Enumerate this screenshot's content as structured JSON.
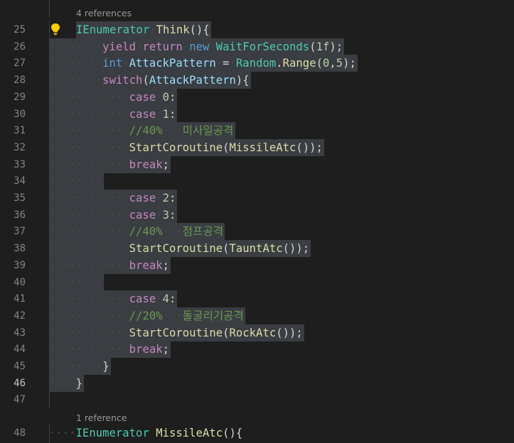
{
  "editor": {
    "codelens": [
      {
        "before_line": "25",
        "text": "4 references"
      },
      {
        "before_line": "48",
        "text": "1 reference"
      }
    ],
    "lightbulb_icon": "lightbulb-icon",
    "active_line": "46",
    "lines": [
      {
        "num": "25",
        "sel": true,
        "tokens": [
          [
            "ty",
            "IEnumerator"
          ],
          [
            "ws",
            "·"
          ],
          [
            "fn",
            "Think"
          ],
          [
            "pl",
            "(){"
          ]
        ]
      },
      {
        "num": "26",
        "sel": true,
        "tokens": [
          [
            "ws",
            "········"
          ],
          [
            "ctl",
            "yield"
          ],
          [
            "ws",
            "·"
          ],
          [
            "ctl",
            "return"
          ],
          [
            "ws",
            "·"
          ],
          [
            "kw",
            "new"
          ],
          [
            "ws",
            "·"
          ],
          [
            "ty",
            "WaitForSeconds"
          ],
          [
            "pl",
            "("
          ],
          [
            "numl",
            "1f"
          ],
          [
            "pl",
            ");"
          ]
        ]
      },
      {
        "num": "27",
        "sel": true,
        "tokens": [
          [
            "ws",
            "········"
          ],
          [
            "kw",
            "int"
          ],
          [
            "ws",
            "·"
          ],
          [
            "var",
            "AttackPattern"
          ],
          [
            "ws",
            "·"
          ],
          [
            "pl",
            "="
          ],
          [
            "ws",
            "·"
          ],
          [
            "ty",
            "Random"
          ],
          [
            "pl",
            "."
          ],
          [
            "fn",
            "Range"
          ],
          [
            "pl",
            "("
          ],
          [
            "numl",
            "0"
          ],
          [
            "pl",
            ","
          ],
          [
            "numl",
            "5"
          ],
          [
            "pl",
            ");"
          ]
        ]
      },
      {
        "num": "28",
        "sel": true,
        "tokens": [
          [
            "ws",
            "········"
          ],
          [
            "ctl",
            "switch"
          ],
          [
            "pl",
            "("
          ],
          [
            "var",
            "AttackPattern"
          ],
          [
            "pl",
            "){"
          ]
        ]
      },
      {
        "num": "29",
        "sel": true,
        "tokens": [
          [
            "ws",
            "············"
          ],
          [
            "ctl",
            "case"
          ],
          [
            "ws",
            "·"
          ],
          [
            "numl",
            "0"
          ],
          [
            "pl",
            ":"
          ]
        ]
      },
      {
        "num": "30",
        "sel": true,
        "tokens": [
          [
            "ws",
            "············"
          ],
          [
            "ctl",
            "case"
          ],
          [
            "ws",
            "·"
          ],
          [
            "numl",
            "1"
          ],
          [
            "pl",
            ":"
          ]
        ]
      },
      {
        "num": "31",
        "sel": true,
        "tokens": [
          [
            "ws",
            "············"
          ],
          [
            "cmt",
            "//40%"
          ],
          [
            "ws",
            "·-·"
          ],
          [
            "cmt",
            "미사일공격"
          ]
        ]
      },
      {
        "num": "32",
        "sel": true,
        "tokens": [
          [
            "ws",
            "············"
          ],
          [
            "fn",
            "StartCoroutine"
          ],
          [
            "pl",
            "("
          ],
          [
            "fn",
            "MissileAtc"
          ],
          [
            "pl",
            "());"
          ]
        ]
      },
      {
        "num": "33",
        "sel": true,
        "tokens": [
          [
            "ws",
            "············"
          ],
          [
            "ctl",
            "break"
          ],
          [
            "pl",
            ";"
          ]
        ]
      },
      {
        "num": "34",
        "sel": true,
        "tokens": [
          [
            "ws",
            "········"
          ]
        ]
      },
      {
        "num": "35",
        "sel": true,
        "tokens": [
          [
            "ws",
            "············"
          ],
          [
            "ctl",
            "case"
          ],
          [
            "ws",
            "·"
          ],
          [
            "numl",
            "2"
          ],
          [
            "pl",
            ":"
          ]
        ]
      },
      {
        "num": "36",
        "sel": true,
        "tokens": [
          [
            "ws",
            "············"
          ],
          [
            "ctl",
            "case"
          ],
          [
            "ws",
            "·"
          ],
          [
            "numl",
            "3"
          ],
          [
            "pl",
            ":"
          ]
        ]
      },
      {
        "num": "37",
        "sel": true,
        "tokens": [
          [
            "ws",
            "············"
          ],
          [
            "cmt",
            "//40%"
          ],
          [
            "ws",
            "·-·"
          ],
          [
            "cmt",
            "점프공격"
          ]
        ]
      },
      {
        "num": "38",
        "sel": true,
        "tokens": [
          [
            "ws",
            "············"
          ],
          [
            "fn",
            "StartCoroutine"
          ],
          [
            "pl",
            "("
          ],
          [
            "fn",
            "TauntAtc"
          ],
          [
            "pl",
            "());"
          ]
        ]
      },
      {
        "num": "39",
        "sel": true,
        "tokens": [
          [
            "ws",
            "············"
          ],
          [
            "ctl",
            "break"
          ],
          [
            "pl",
            ";"
          ]
        ]
      },
      {
        "num": "40",
        "sel": true,
        "tokens": [
          [
            "ws",
            "········"
          ]
        ]
      },
      {
        "num": "41",
        "sel": true,
        "tokens": [
          [
            "ws",
            "············"
          ],
          [
            "ctl",
            "case"
          ],
          [
            "ws",
            "·"
          ],
          [
            "numl",
            "4"
          ],
          [
            "pl",
            ":"
          ]
        ]
      },
      {
        "num": "42",
        "sel": true,
        "tokens": [
          [
            "ws",
            "············"
          ],
          [
            "cmt",
            "//20%"
          ],
          [
            "ws",
            "·-·"
          ],
          [
            "cmt",
            "돌굴리기공격"
          ]
        ]
      },
      {
        "num": "43",
        "sel": true,
        "tokens": [
          [
            "ws",
            "············"
          ],
          [
            "fn",
            "StartCoroutine"
          ],
          [
            "pl",
            "("
          ],
          [
            "fn",
            "RockAtc"
          ],
          [
            "pl",
            "());"
          ]
        ]
      },
      {
        "num": "44",
        "sel": true,
        "tokens": [
          [
            "ws",
            "············"
          ],
          [
            "ctl",
            "break"
          ],
          [
            "pl",
            ";"
          ]
        ]
      },
      {
        "num": "45",
        "sel": true,
        "tokens": [
          [
            "ws",
            "········"
          ],
          [
            "pl",
            "}"
          ]
        ]
      },
      {
        "num": "46",
        "sel": true,
        "tokens": [
          [
            "ws",
            "····"
          ],
          [
            "pl",
            "}"
          ]
        ]
      },
      {
        "num": "47",
        "sel": false,
        "tokens": []
      },
      {
        "num": "48",
        "sel": false,
        "tokens": [
          [
            "ws",
            "····"
          ],
          [
            "ty",
            "IEnumerator"
          ],
          [
            "ws",
            " "
          ],
          [
            "fn",
            "MissileAtc"
          ],
          [
            "pl",
            "(){"
          ]
        ]
      }
    ]
  }
}
